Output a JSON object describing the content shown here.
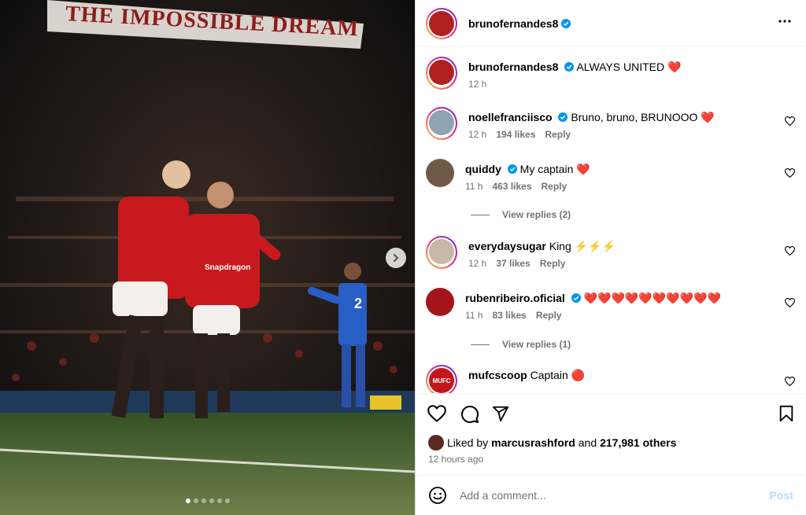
{
  "post": {
    "author": "brunofernandes8",
    "caption": "ALWAYS UNITED ❤️",
    "caption_time": "12 h",
    "banner_text": "THE IMPOSSIBLE DREAM",
    "kit_sponsor": "Snapdragon",
    "player_number": "2",
    "carousel_dots": 6,
    "carousel_active": 0
  },
  "comments": [
    {
      "user": "noellefranciisco",
      "verified": true,
      "text": "Bruno, bruno, BRUNOOO ❤️",
      "time": "12 h",
      "likes": "194 likes",
      "reply": "Reply"
    },
    {
      "user": "quiddy",
      "verified": true,
      "text": "My captain ❤️",
      "time": "11 h",
      "likes": "463 likes",
      "reply": "Reply",
      "view_replies": "View replies (2)"
    },
    {
      "user": "everydaysugar",
      "verified": false,
      "text": "King ⚡⚡⚡",
      "time": "12 h",
      "likes": "37 likes",
      "reply": "Reply"
    },
    {
      "user": "rubenribeiro.oficial",
      "verified": true,
      "text": "❤️❤️❤️❤️❤️❤️❤️❤️❤️❤️",
      "time": "11 h",
      "likes": "83 likes",
      "reply": "Reply",
      "view_replies": "View replies (1)"
    },
    {
      "user": "mufcscoop",
      "verified": false,
      "text": "Captain 🔴",
      "avatar_text": "MUFC"
    }
  ],
  "liked_by": {
    "prefix": "Liked by",
    "user": "marcusrashford",
    "and": "and",
    "others": "217,981 others"
  },
  "time_ago": "12 hours ago",
  "add_comment": {
    "placeholder": "Add a comment...",
    "post_label": "Post"
  },
  "colors": {
    "verified": "#0095f6",
    "post_disabled": "#b3dbff",
    "meta": "#737373"
  }
}
